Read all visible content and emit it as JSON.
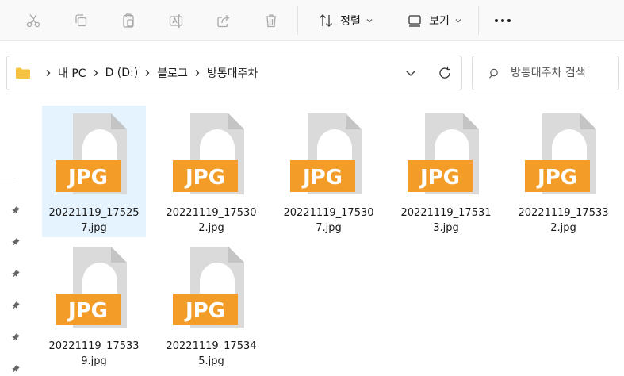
{
  "toolbar": {
    "buttons": [
      {
        "name": "cut",
        "icon": "scissors-icon",
        "enabled": false
      },
      {
        "name": "copy",
        "icon": "copy-icon",
        "enabled": false
      },
      {
        "name": "paste",
        "icon": "clipboard-icon",
        "enabled": false
      },
      {
        "name": "rename",
        "icon": "rename-icon",
        "enabled": false
      },
      {
        "name": "share",
        "icon": "share-icon",
        "enabled": false
      },
      {
        "name": "delete",
        "icon": "trash-icon",
        "enabled": false
      }
    ],
    "sort_label": "정렬",
    "view_label": "보기",
    "more_icon": "ellipsis-icon"
  },
  "address": {
    "folder_icon": "folder-icon",
    "breadcrumbs": [
      "내 PC",
      "D (D:)",
      "블로그",
      "방통대주차"
    ]
  },
  "search": {
    "placeholder": "방통대주차 검색"
  },
  "files": [
    {
      "name": "20221119_175257.jpg",
      "type_label": "JPG",
      "selected": true
    },
    {
      "name": "20221119_175302.jpg",
      "type_label": "JPG",
      "selected": false
    },
    {
      "name": "20221119_175307.jpg",
      "type_label": "JPG",
      "selected": false
    },
    {
      "name": "20221119_175313.jpg",
      "type_label": "JPG",
      "selected": false
    },
    {
      "name": "20221119_175332.jpg",
      "type_label": "JPG",
      "selected": false
    },
    {
      "name": "20221119_175339.jpg",
      "type_label": "JPG",
      "selected": false
    },
    {
      "name": "20221119_175345.jpg",
      "type_label": "JPG",
      "selected": false
    }
  ],
  "colors": {
    "jpg_badge": "#f39c27",
    "selection": "#e5f3ff",
    "disabled_icon": "#a9a9a9",
    "folder_yellow": "#f5c242"
  }
}
